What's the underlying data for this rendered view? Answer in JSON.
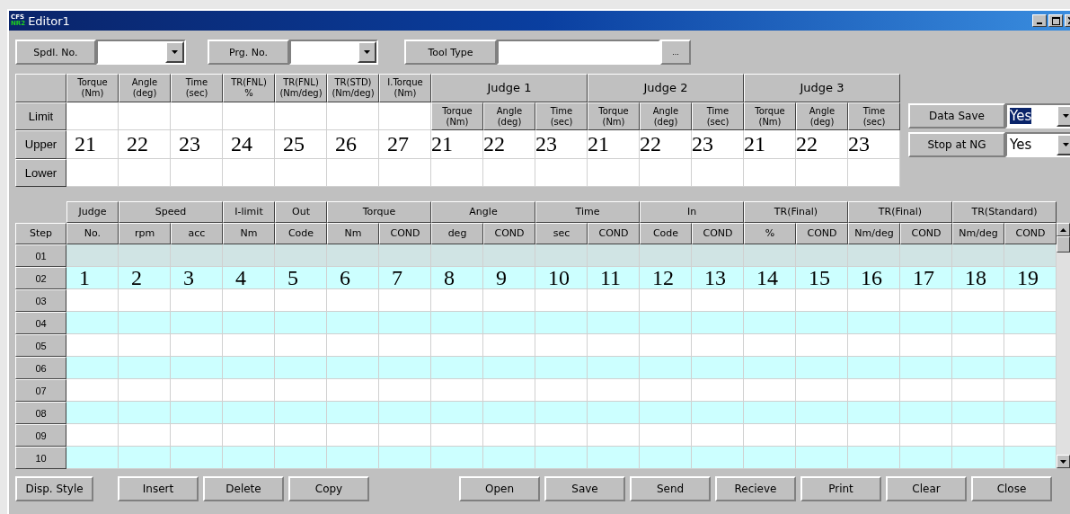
{
  "window": {
    "title": "Editor1",
    "logo": [
      "CFS",
      "NR2"
    ]
  },
  "top_fields": [
    {
      "label": "Spdl. No.",
      "kind": "combo"
    },
    {
      "label": "Prg. No.",
      "kind": "combo"
    },
    {
      "label": "Tool Type",
      "kind": "browse",
      "browse_button": "..."
    }
  ],
  "limits": {
    "columns": [
      "Torque\n(Nm)",
      "Angle\n(deg)",
      "Time\n(sec)",
      "TR(FNL)\n%",
      "TR(FNL)\n(Nm/deg)",
      "TR(STD)\n(Nm/deg)",
      "I.Torque\n(Nm)"
    ],
    "judges": [
      {
        "title": "Judge 1",
        "columns": [
          "Torque\n(Nm)",
          "Angle\n(deg)",
          "Time\n(sec)"
        ]
      },
      {
        "title": "Judge 2",
        "columns": [
          "Torque\n(Nm)",
          "Angle\n(deg)",
          "Time\n(sec)"
        ]
      },
      {
        "title": "Judge 3",
        "columns": [
          "Torque\n(Nm)",
          "Angle\n(deg)",
          "Time\n(sec)"
        ]
      }
    ],
    "rows": [
      {
        "label": "Limit"
      },
      {
        "label": "Upper",
        "values": [
          "21",
          "22",
          "23",
          "24",
          "25",
          "26",
          "27",
          "21",
          "22",
          "23",
          "21",
          "22",
          "23",
          "21",
          "22",
          "23"
        ]
      },
      {
        "label": "Lower"
      }
    ]
  },
  "options": [
    {
      "label": "Data Save",
      "value": "Yes",
      "selected": true
    },
    {
      "label": "Stop at NG",
      "value": "Yes",
      "selected": false
    }
  ],
  "steps": {
    "groups": [
      {
        "label": "Judge",
        "columns": [
          "No."
        ]
      },
      {
        "label": "Speed",
        "columns": [
          "rpm",
          "acc"
        ]
      },
      {
        "label": "I-limit",
        "columns": [
          "Nm"
        ]
      },
      {
        "label": "Out",
        "columns": [
          "Code"
        ]
      },
      {
        "label": "Torque",
        "columns": [
          "Nm",
          "COND"
        ]
      },
      {
        "label": "Angle",
        "columns": [
          "deg",
          "COND"
        ]
      },
      {
        "label": "Time",
        "columns": [
          "sec",
          "COND"
        ]
      },
      {
        "label": "In",
        "columns": [
          "Code",
          "COND"
        ]
      },
      {
        "label": "TR(Final)",
        "columns": [
          "%",
          "COND"
        ]
      },
      {
        "label": "TR(Final)",
        "columns": [
          "Nm/deg",
          "COND"
        ]
      },
      {
        "label": "TR(Standard)",
        "columns": [
          "Nm/deg",
          "COND"
        ]
      }
    ],
    "step_header": "Step",
    "rows": [
      {
        "step": "01",
        "selected": true
      },
      {
        "step": "02",
        "selected": false,
        "cells": [
          "1",
          "2",
          "3",
          "4",
          "5",
          "6",
          "7",
          "8",
          "9",
          "10",
          "11",
          "12",
          "13",
          "14",
          "15",
          "16",
          "17",
          "18",
          "19"
        ]
      },
      {
        "step": "03",
        "selected": false
      },
      {
        "step": "04",
        "selected": false
      },
      {
        "step": "05",
        "selected": false
      },
      {
        "step": "06",
        "selected": false
      },
      {
        "step": "07",
        "selected": false
      },
      {
        "step": "08",
        "selected": false
      },
      {
        "step": "09",
        "selected": false
      },
      {
        "step": "10",
        "selected": false
      }
    ]
  },
  "button_groups": [
    [
      "Disp. Style"
    ],
    [
      "Insert",
      "Delete",
      "Copy"
    ],
    [
      "Open",
      "Save",
      "Send",
      "Recieve",
      "Print",
      "Clear",
      "Close"
    ]
  ]
}
